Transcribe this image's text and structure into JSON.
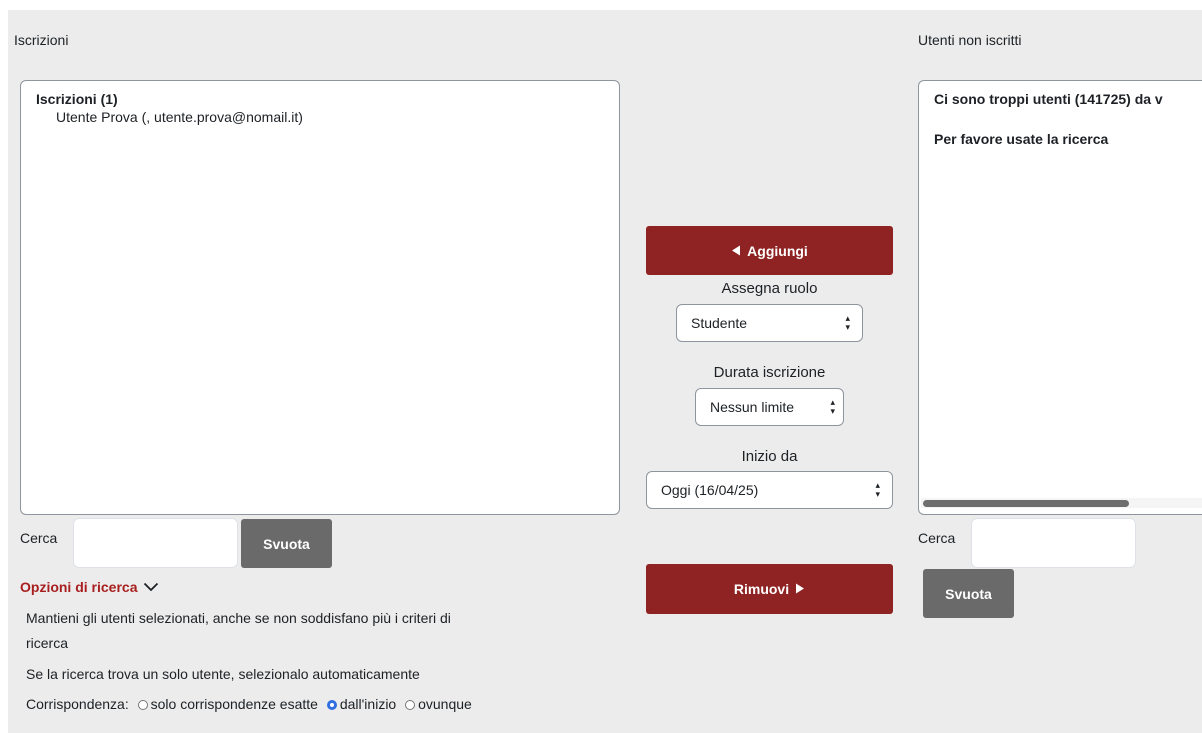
{
  "left": {
    "heading": "Iscrizioni",
    "group_label": "Iscrizioni (1)",
    "users": [
      "Utente Prova (, utente.prova@nomail.it)"
    ],
    "search_label": "Cerca",
    "clear_label": "Svuota"
  },
  "search_options": {
    "toggle_label": "Opzioni di ricerca",
    "keep_selected": "Mantieni gli utenti selezionati, anche se non soddisfano più i criteri di",
    "keep_selected_cont": "ricerca",
    "auto_select": "Se la ricerca trova un solo utente, selezionalo automaticamente",
    "match_label": "Corrispondenza:",
    "match_options": [
      "solo corrispondenze esatte",
      "dall'inizio",
      "ovunque"
    ],
    "match_selected": "dall'inizio"
  },
  "middle": {
    "add_label": "Aggiungi",
    "assign_role_label": "Assegna ruolo",
    "role_value": "Studente",
    "duration_label": "Durata iscrizione",
    "duration_value": "Nessun limite",
    "start_label": "Inizio da",
    "start_value": "Oggi (16/04/25)",
    "remove_label": "Rimuovi"
  },
  "right": {
    "heading": "Utenti non iscritti",
    "too_many": "Ci sono troppi utenti (141725) da v",
    "please_search": "Per favore usate la ricerca",
    "search_label": "Cerca",
    "clear_label": "Svuota"
  },
  "colors": {
    "accent_red": "#8f2222",
    "link_red": "#a81f1f",
    "button_grey": "#6a6a6a",
    "panel_bg": "#ececec",
    "radio_selected": "#2f6fe0"
  }
}
